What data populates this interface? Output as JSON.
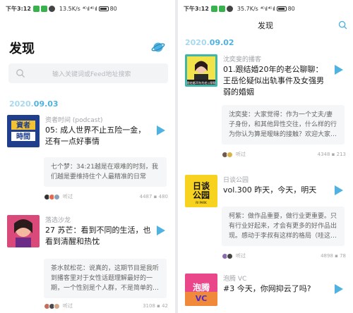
{
  "status_left": {
    "time": "下午3:12",
    "speed": "13.5K/s",
    "signal": "⁴ᴳ ıl ⁴ᴳ ıl",
    "battery": "80"
  },
  "status_right": {
    "time": "下午3:12",
    "speed": "35.7K/s",
    "signal": "⁴ᴳ ıl ⁴ᴳ ıl",
    "battery": "80"
  },
  "left": {
    "title": "发现",
    "search_placeholder": "输入关键词或Feed地址搜索",
    "date_year": "2020.",
    "date_md": "09.03",
    "cards": [
      {
        "source": "资者时间 (podcast)",
        "title": "05: 成人世界不止五险一金，还有一点好事情",
        "comment": "七个梦：34:21越是在艰难的时刻，我们越是要维持住个人最精准的日常",
        "heard": "听过",
        "stats": "4487 ▪ 480"
      },
      {
        "source": "落选沙龙",
        "title": "27 苏芒：看到不同的生活，也看到清醒和热忱",
        "comment": "茶水就松花：说真的，这期节目是我听到播客里对于女性话题理解最好的一期，一个性别是个人群，不是简单的…",
        "heard": "听过",
        "stats": "3108 ▪ 42"
      }
    ]
  },
  "right": {
    "title": "发现",
    "date_year": "2020.",
    "date_md": "09.02",
    "cards": [
      {
        "source": "沈奕斐的播客",
        "title": "01.跟结婚20年的老公聊聊：王岳伦疑似出轨事件及女强男弱的婚姻",
        "comment": "沈奕斐：大家觉得：作为一个丈夫/妻子身份，和其他异性交往，什么样的行为你认为算是暧昧的接触？欢迎大家…",
        "heard": "听过",
        "stats": "4348 ▪ 213"
      },
      {
        "source": "日谈公园",
        "title": "vol.300 昨天，今天，明天",
        "comment": "柯紫：做作品重要，做行业更重要。只有行业好起来，才会有更多的好作品出现。感动于李叔有这样的格局（哇这…",
        "heard": "听过",
        "stats": "4898 ▪ 78"
      },
      {
        "source": "泡腾 VC",
        "title": "#3 今天，你网抑云了吗?",
        "comment": "",
        "heard": "",
        "stats": ""
      }
    ]
  },
  "covers": {
    "c1_l1": "資者",
    "c1_l2": "時間",
    "c3_text": "跟结婚20年的老公聊聊",
    "c4_l1": "日谈",
    "c4_l2": "公园",
    "c4_sub": "RI PARK",
    "c5_l1": "泡腾",
    "c5_l2": "VC"
  },
  "colors": {
    "accent": "#4fb2e0",
    "accent_light": "#a6d8ef",
    "play": "#4fb2e0"
  }
}
